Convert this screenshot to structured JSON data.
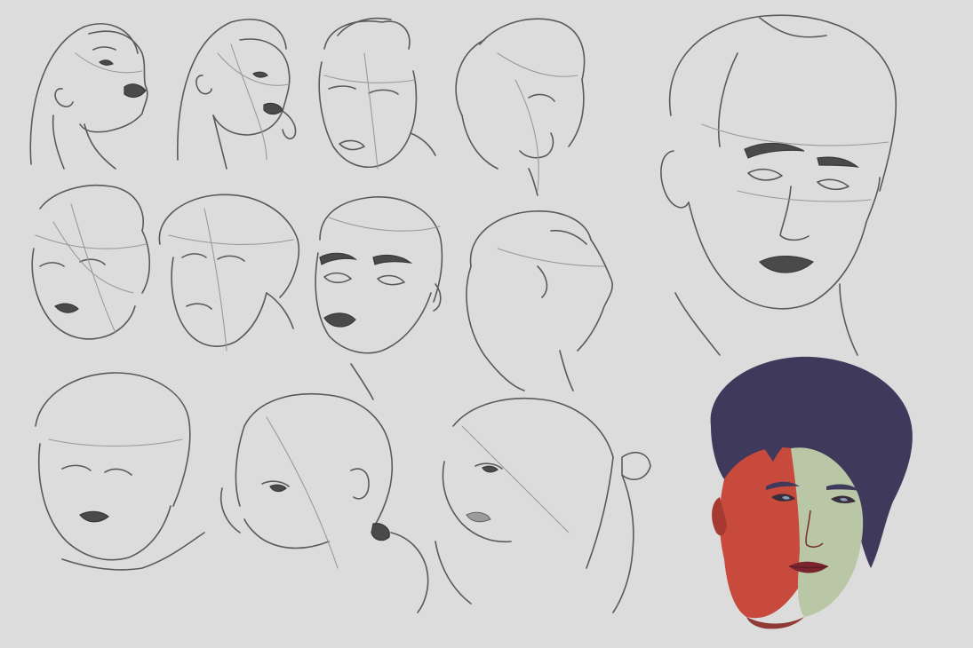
{
  "image": {
    "description_label": "",
    "background_color": "#dcdcdc",
    "line_color": "#5a5a5a",
    "accent_colors": {
      "hair": "#3f3a5c",
      "skin_warm": "#c84a3c",
      "skin_cool": "#b9c7a6"
    },
    "sketch_count": 13,
    "painted_count": 1
  }
}
